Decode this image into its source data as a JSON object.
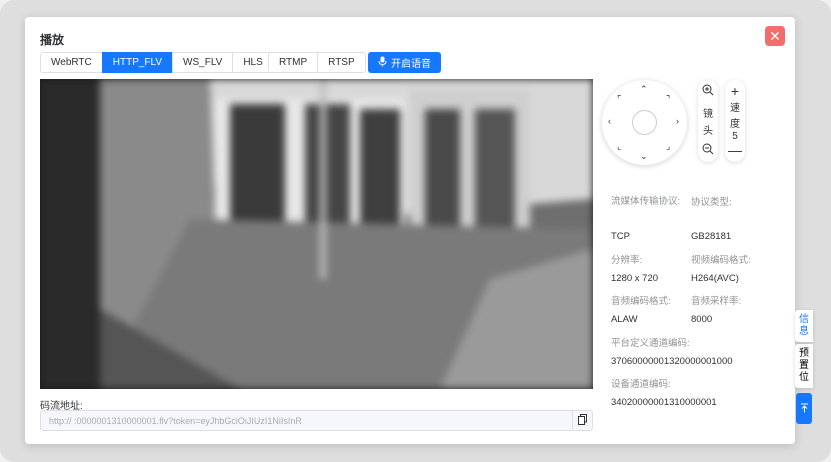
{
  "dialog": {
    "title": "播放"
  },
  "tabs_protocol": [
    "WebRTC",
    "HTTP_FLV",
    "WS_FLV",
    "HLS"
  ],
  "tabs_protocol_active": "HTTP_FLV",
  "tabs_stream": [
    "RTMP",
    "RTSP"
  ],
  "voice_button": "开启语音",
  "stream_url": {
    "label": "码流地址:",
    "value": "http://                                              :0000001310000001.flv?token=eyJhbGciOiJIUzI1NiIsInR"
  },
  "ptz": {
    "lens_label": [
      "镜",
      "头"
    ],
    "speed_label": [
      "速",
      "度"
    ],
    "speed_value": "5"
  },
  "info": {
    "transport_label": "流媒体传输协议:",
    "transport_value": "TCP",
    "protocol_label": "协议类型:",
    "protocol_value": "GB28181",
    "resolution_label": "分辨率:",
    "resolution_value": "1280 x 720",
    "video_codec_label": "视频编码格式:",
    "video_codec_value": "H264(AVC)",
    "audio_codec_label": "音频编码格式:",
    "audio_codec_value": "ALAW",
    "sample_rate_label": "音频采样率:",
    "sample_rate_value": "8000",
    "platform_channel_label": "平台定义通道编码:",
    "platform_channel_value": "37060000001320000001000",
    "device_channel_label": "设备通道编码:",
    "device_channel_value": "34020000001310000001"
  },
  "side_tabs": {
    "info": "信息",
    "preset": "预置位"
  },
  "colors": {
    "primary": "#1677ff",
    "danger": "#f56c6c"
  }
}
